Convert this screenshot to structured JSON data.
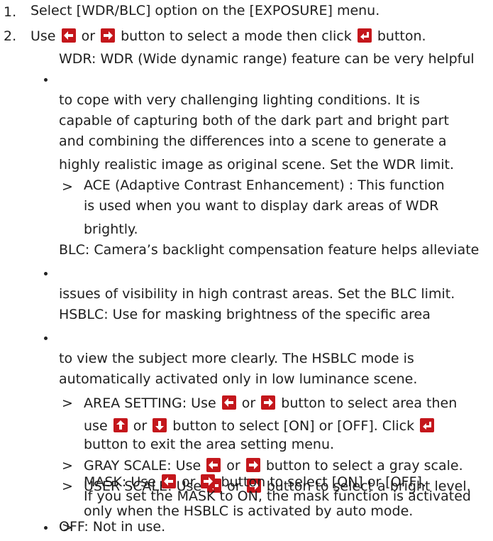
{
  "steps": [
    {
      "number": "1.",
      "text": "Select [WDR/BLC] option on the [EXPOSURE] menu."
    },
    {
      "number": "2.",
      "text_a": "Use",
      "text_b": "or",
      "text_c": "button to select a mode then click",
      "text_d": "button."
    }
  ],
  "wdr": {
    "lines": [
      "WDR: WDR (Wide dynamic range) feature can be very helpful",
      "to cope with very challenging lighting conditions. It is",
      "capable of capturing both of the dark part and bright part",
      "and combining the differences into a scene to generate a",
      "highly realistic image as original scene. Set the WDR limit."
    ],
    "ace": {
      "marker": ">",
      "lines": [
        "ACE (Adaptive Contrast Enhancement) : This function",
        "is used when you want to display dark areas of WDR",
        "brightly."
      ]
    }
  },
  "blc": {
    "lines": [
      "BLC: Camera’s backlight compensation feature helps alleviate",
      "issues of visibility in high contrast areas. Set the BLC limit."
    ]
  },
  "hsblc": {
    "lines": [
      "HSBLC: Use for masking brightness of the specific area",
      "to view the subject more clearly. The HSBLC mode is",
      "automatically activated only in low luminance scene."
    ],
    "area": {
      "marker": ">",
      "l1_a": "AREA SETTING: Use",
      "l1_b": "or",
      "l1_c": "button to select area then",
      "l2_a": "use",
      "l2_b": "or",
      "l2_c": "button to select [ON] or [OFF]. Click",
      "l3": "button to exit the area setting menu."
    },
    "gray": {
      "marker": ">",
      "a": "GRAY SCALE: Use",
      "b": "or",
      "c": "button to select a gray scale."
    },
    "user": {
      "marker": ">",
      "a": "USER SCALE: Use",
      "b": "or",
      "c": "button to select a bright level."
    },
    "mask": {
      "marker": ">",
      "a": "MASK: Use",
      "b": "or",
      "c": "button to select [ON] or [OFF].",
      "l2": "If you set the MASK to ON, the mask function is activated",
      "l3": "only when the HSBLC is activated by auto mode."
    }
  },
  "off": {
    "text": "OFF: Not in use."
  },
  "colors": {
    "button_red": "#c4171c",
    "text": "#1e1e1e"
  },
  "icons": [
    "left-arrow-button-icon",
    "right-arrow-button-icon",
    "up-arrow-button-icon",
    "down-arrow-button-icon",
    "enter-button-icon"
  ]
}
